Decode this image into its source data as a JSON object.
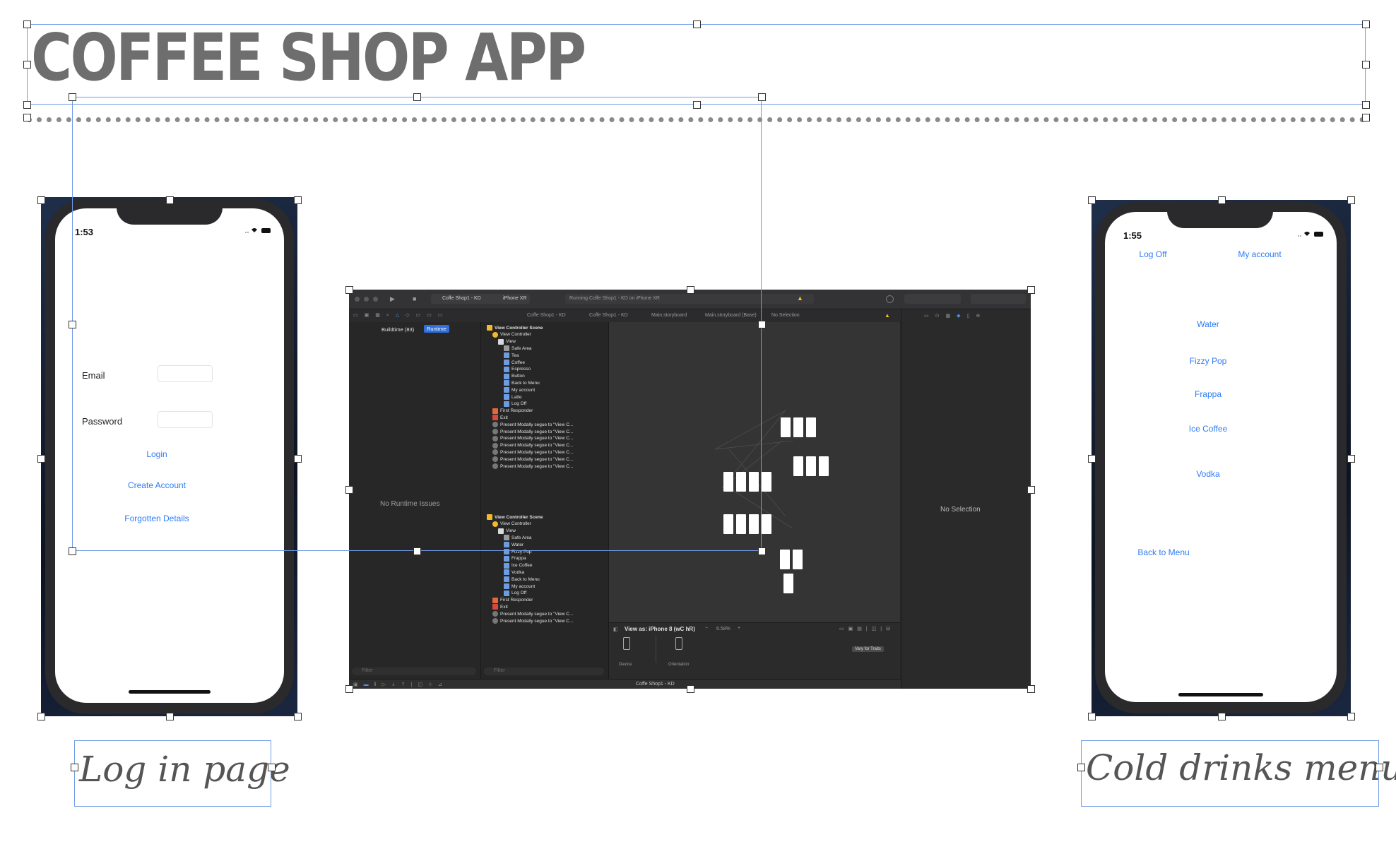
{
  "slide": {
    "title": "COFFEE SHOP APP",
    "caption_left": "Log in page",
    "caption_right": "Cold drinks menu"
  },
  "colors": {
    "title_gray": "#6e6e6e",
    "selection_blue": "#6f9ae6",
    "ios_link_blue": "#2f7cf6",
    "xcode_dark": "#282828"
  },
  "login_phone": {
    "time": "1:53",
    "status_icons": "signal-wifi-battery",
    "email_label": "Email",
    "password_label": "Password",
    "login_link": "Login",
    "create_account_link": "Create Account",
    "forgotten_link": "Forgotten Details"
  },
  "drinks_phone": {
    "time": "1:55",
    "log_off": "Log Off",
    "my_account": "My account",
    "items": [
      "Water",
      "Fizzy Pop",
      "Frappa",
      "Ice Coffee",
      "Vodka"
    ],
    "back": "Back to Menu"
  },
  "xcode": {
    "scheme": "Coffe Shop1 - KD",
    "device": "iPhone XR",
    "activity": "Running Coffe Shop1 - KD on iPhone XR",
    "breadcrumb": [
      "Coffe Shop1 - KD",
      "Coffe Shop1 - KD",
      "Main.storyboard",
      "Main.storyboard (Base)",
      "No Selection"
    ],
    "issue_tabs": [
      "Buildtime (83)",
      "Runtime"
    ],
    "no_runtime_issues": "No Runtime Issues",
    "no_selection": "No Selection",
    "outline_scene1": [
      {
        "t": "View Controller Scene",
        "d": 0,
        "k": "scene"
      },
      {
        "t": "View Controller",
        "d": 1,
        "k": "vc"
      },
      {
        "t": "View",
        "d": 2,
        "k": "view"
      },
      {
        "t": "Safe Area",
        "d": 3,
        "k": "item"
      },
      {
        "t": "Tea",
        "d": 3,
        "k": "btn"
      },
      {
        "t": "Coffee",
        "d": 3,
        "k": "btn"
      },
      {
        "t": "Espresso",
        "d": 3,
        "k": "btn"
      },
      {
        "t": "Button",
        "d": 3,
        "k": "btn"
      },
      {
        "t": "Back to Menu",
        "d": 3,
        "k": "btn"
      },
      {
        "t": "My account",
        "d": 3,
        "k": "btn"
      },
      {
        "t": "Latte",
        "d": 3,
        "k": "btn"
      },
      {
        "t": "Log Off",
        "d": 3,
        "k": "btn"
      },
      {
        "t": "First Responder",
        "d": 1,
        "k": "fr"
      },
      {
        "t": "Exit",
        "d": 1,
        "k": "exit"
      },
      {
        "t": "Present Modally segue to \"View C...",
        "d": 1,
        "k": "segue"
      },
      {
        "t": "Present Modally segue to \"View C...",
        "d": 1,
        "k": "segue"
      },
      {
        "t": "Present Modally segue to \"View C...",
        "d": 1,
        "k": "segue"
      },
      {
        "t": "Present Modally segue to \"View C...",
        "d": 1,
        "k": "segue"
      },
      {
        "t": "Present Modally segue to \"View C...",
        "d": 1,
        "k": "segue"
      },
      {
        "t": "Present Modally segue to \"View C...",
        "d": 1,
        "k": "segue"
      },
      {
        "t": "Present Modally segue to \"View C...",
        "d": 1,
        "k": "segue"
      }
    ],
    "outline_scene2": [
      {
        "t": "View Controller Scene",
        "d": 0,
        "k": "scene"
      },
      {
        "t": "View Controller",
        "d": 1,
        "k": "vc"
      },
      {
        "t": "View",
        "d": 2,
        "k": "view"
      },
      {
        "t": "Safe Area",
        "d": 3,
        "k": "item"
      },
      {
        "t": "Water",
        "d": 3,
        "k": "btn"
      },
      {
        "t": "Fizzy Pop",
        "d": 3,
        "k": "btn"
      },
      {
        "t": "Frappa",
        "d": 3,
        "k": "btn"
      },
      {
        "t": "Ice Coffee",
        "d": 3,
        "k": "btn"
      },
      {
        "t": "Vodka",
        "d": 3,
        "k": "btn"
      },
      {
        "t": "Back to Menu",
        "d": 3,
        "k": "btn"
      },
      {
        "t": "My account",
        "d": 3,
        "k": "btn"
      },
      {
        "t": "Log Off",
        "d": 3,
        "k": "btn"
      },
      {
        "t": "First Responder",
        "d": 1,
        "k": "fr"
      },
      {
        "t": "Exit",
        "d": 1,
        "k": "exit"
      },
      {
        "t": "Present Modally segue to \"View C...",
        "d": 1,
        "k": "segue"
      },
      {
        "t": "Present Modally segue to \"View C...",
        "d": 1,
        "k": "segue"
      }
    ],
    "view_as": "View as: iPhone 8 (wC hR)",
    "zoom": "6.58%",
    "device_label": "Device",
    "orientation_label": "Orientation",
    "vary_for_traits": "Vary for Traits",
    "filter_placeholder": "Filter",
    "status_target": "Coffe Shop1 - KD"
  }
}
